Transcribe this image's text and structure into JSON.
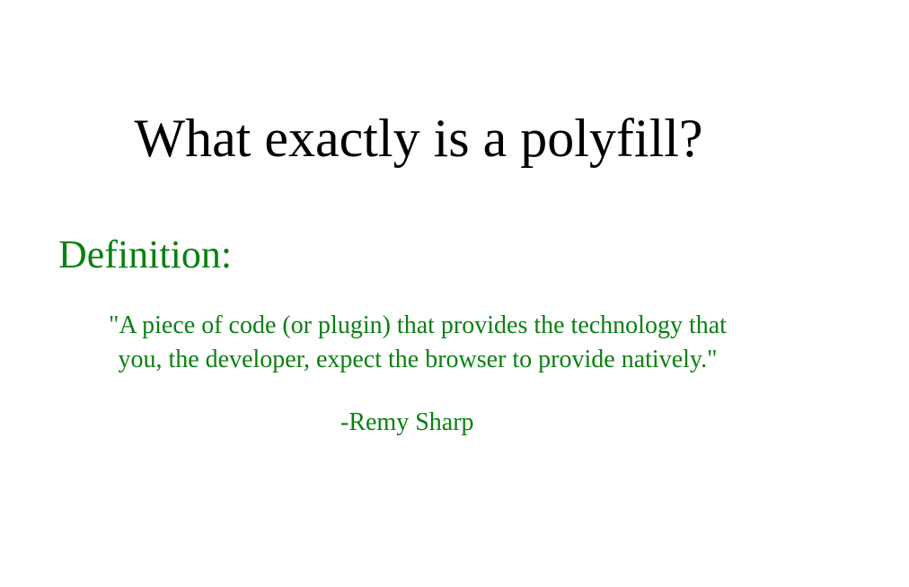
{
  "slide": {
    "title": "What exactly is a polyfill?",
    "definition_heading": "Definition:",
    "quote_lines": [
      "\"A piece of code (or plugin) that provides the technology that",
      "you, the developer, expect the browser to provide natively.\""
    ],
    "attribution": "-Remy Sharp"
  },
  "colors": {
    "title": "#000000",
    "accent_green": "#0a8012",
    "background": "#ffffff"
  }
}
